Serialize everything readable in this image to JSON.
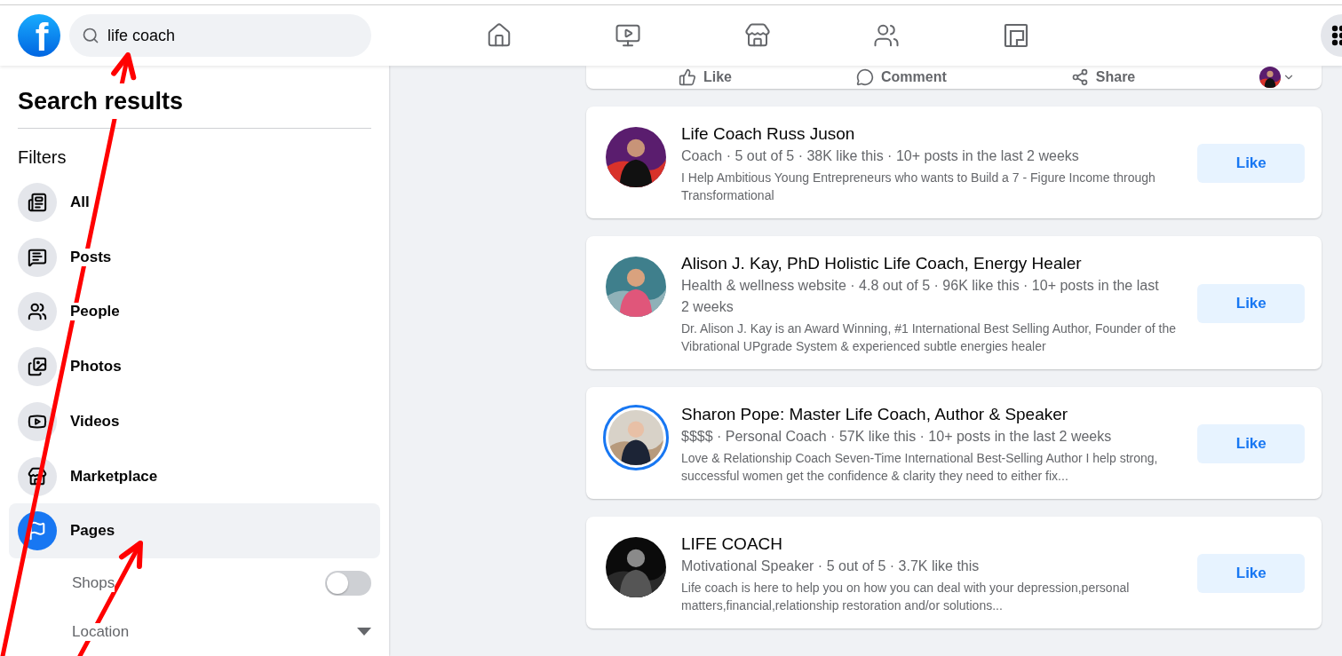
{
  "header": {
    "logo": "f",
    "search": {
      "value": "life coach"
    }
  },
  "top_post_actions": [
    "Like",
    "Comment",
    "Share"
  ],
  "sidebar": {
    "title": "Search results",
    "filters_heading": "Filters",
    "filters": [
      {
        "label": "All",
        "selected": false
      },
      {
        "label": "Posts",
        "selected": false
      },
      {
        "label": "People",
        "selected": false
      },
      {
        "label": "Photos",
        "selected": false
      },
      {
        "label": "Videos",
        "selected": false
      },
      {
        "label": "Marketplace",
        "selected": false
      },
      {
        "label": "Pages",
        "selected": true
      }
    ],
    "sub_filters": [
      {
        "kind": "toggle",
        "label": "Shops",
        "on": false
      },
      {
        "kind": "dropdown",
        "label": "Location"
      }
    ]
  },
  "results": [
    {
      "name": "Life Coach Russ Juson",
      "meta": "Coach · 5 out of 5 · 38K like this · 10+ posts in the last 2 weeks",
      "description": "I Help Ambitious Young Entrepreneurs who wants to Build a 7 - Figure Income through Transformational",
      "story_ring": false,
      "button": "Like"
    },
    {
      "name": "Alison J. Kay, PhD Holistic Life Coach, Energy Healer",
      "meta": "Health & wellness website · 4.8 out of 5 · 96K like this · 10+ posts in the last 2 weeks",
      "description": "Dr. Alison J. Kay is an Award Winning, #1 International Best Selling Author, Founder of the Vibrational UPgrade System & experienced subtle energies healer",
      "story_ring": false,
      "button": "Like"
    },
    {
      "name": "Sharon Pope: Master Life Coach, Author & Speaker",
      "meta": "$$$$ · Personal Coach · 57K like this · 10+ posts in the last 2 weeks",
      "description": "Love & Relationship Coach Seven-Time International Best-Selling Author I help strong, successful women get the confidence & clarity they need to either fix...",
      "story_ring": true,
      "button": "Like"
    },
    {
      "name": "LIFE COACH",
      "meta": "Motivational Speaker · 5 out of 5 · 3.7K like this",
      "description": "Life coach is here to help you on how you can deal with your depression,personal matters,financial,relationship restoration and/or solutions...",
      "story_ring": false,
      "button": "Like"
    }
  ],
  "annotations": [
    {
      "kind": "arrow"
    },
    {
      "kind": "arrow"
    }
  ]
}
